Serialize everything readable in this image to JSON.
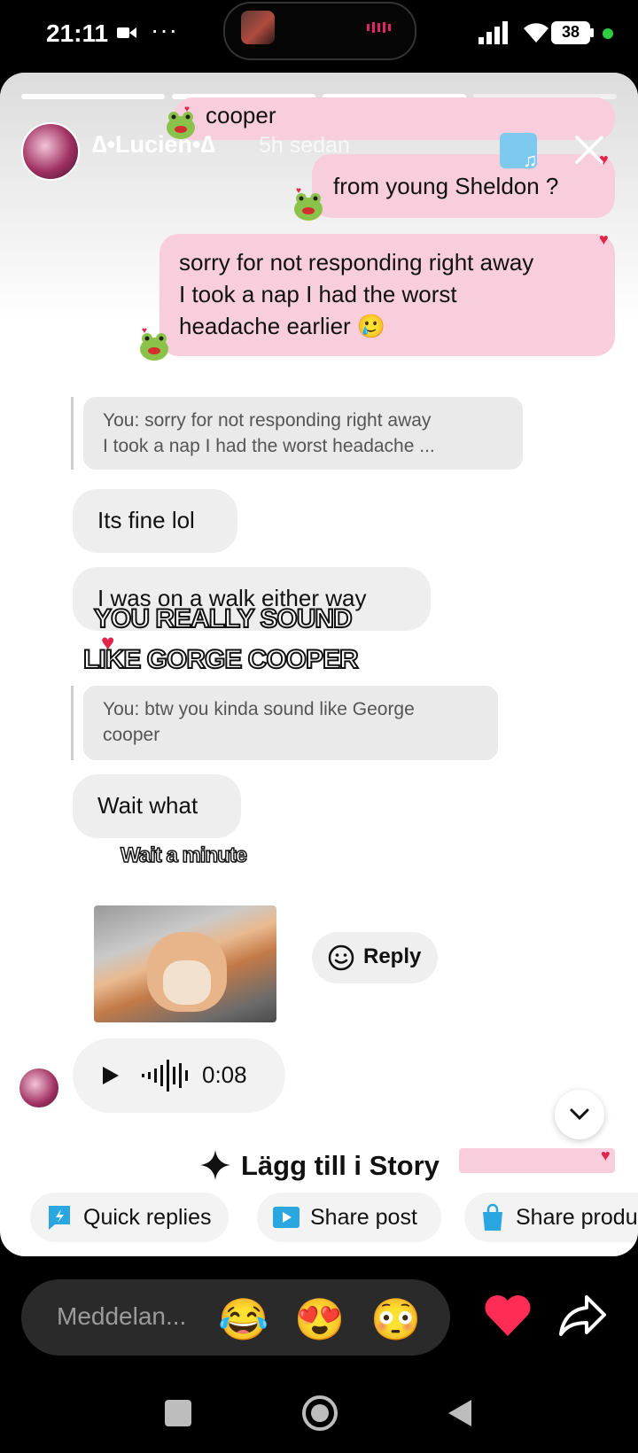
{
  "status_bar": {
    "time": "21:11",
    "more": "···",
    "battery": "38"
  },
  "story": {
    "username": "∆•Lucien•∆",
    "time_ago": "5h sedan"
  },
  "messages": {
    "cooper": "cooper",
    "young_sheldon": "from young Sheldon ?",
    "sorry_l1": "sorry for not responding right away",
    "sorry_l2": "I took a nap I had the worst",
    "sorry_l3": "headache earlier 🥲",
    "quote1_l1": "You: sorry for not responding right away",
    "quote1_l2": "I took a nap I had the worst headache ...",
    "its_fine": "Its fine lol",
    "walk": "I was on a walk either way",
    "quote2_l1": "You: btw you kinda sound like George",
    "quote2_l2": "cooper",
    "wait_what": "Wait what",
    "audio_duration": "0:08"
  },
  "captions": {
    "sound_l1": "YOU REALLY SOUND",
    "sound_l2": "LIKE GORGE COOPER",
    "meme": "Wait a minute"
  },
  "actions": {
    "reply": "Reply",
    "add_to_story": "Lägg till i Story",
    "quick_replies": "Quick replies",
    "share_post": "Share post",
    "share_product": "Share produ"
  },
  "composer": {
    "placeholder": "Meddelan...",
    "emojis": [
      "😂",
      "😍",
      "😳"
    ]
  },
  "colors": {
    "bubble_pink": "#f8cedd",
    "heart": "#e0244a",
    "quick_icon": "#2aa7e0"
  }
}
